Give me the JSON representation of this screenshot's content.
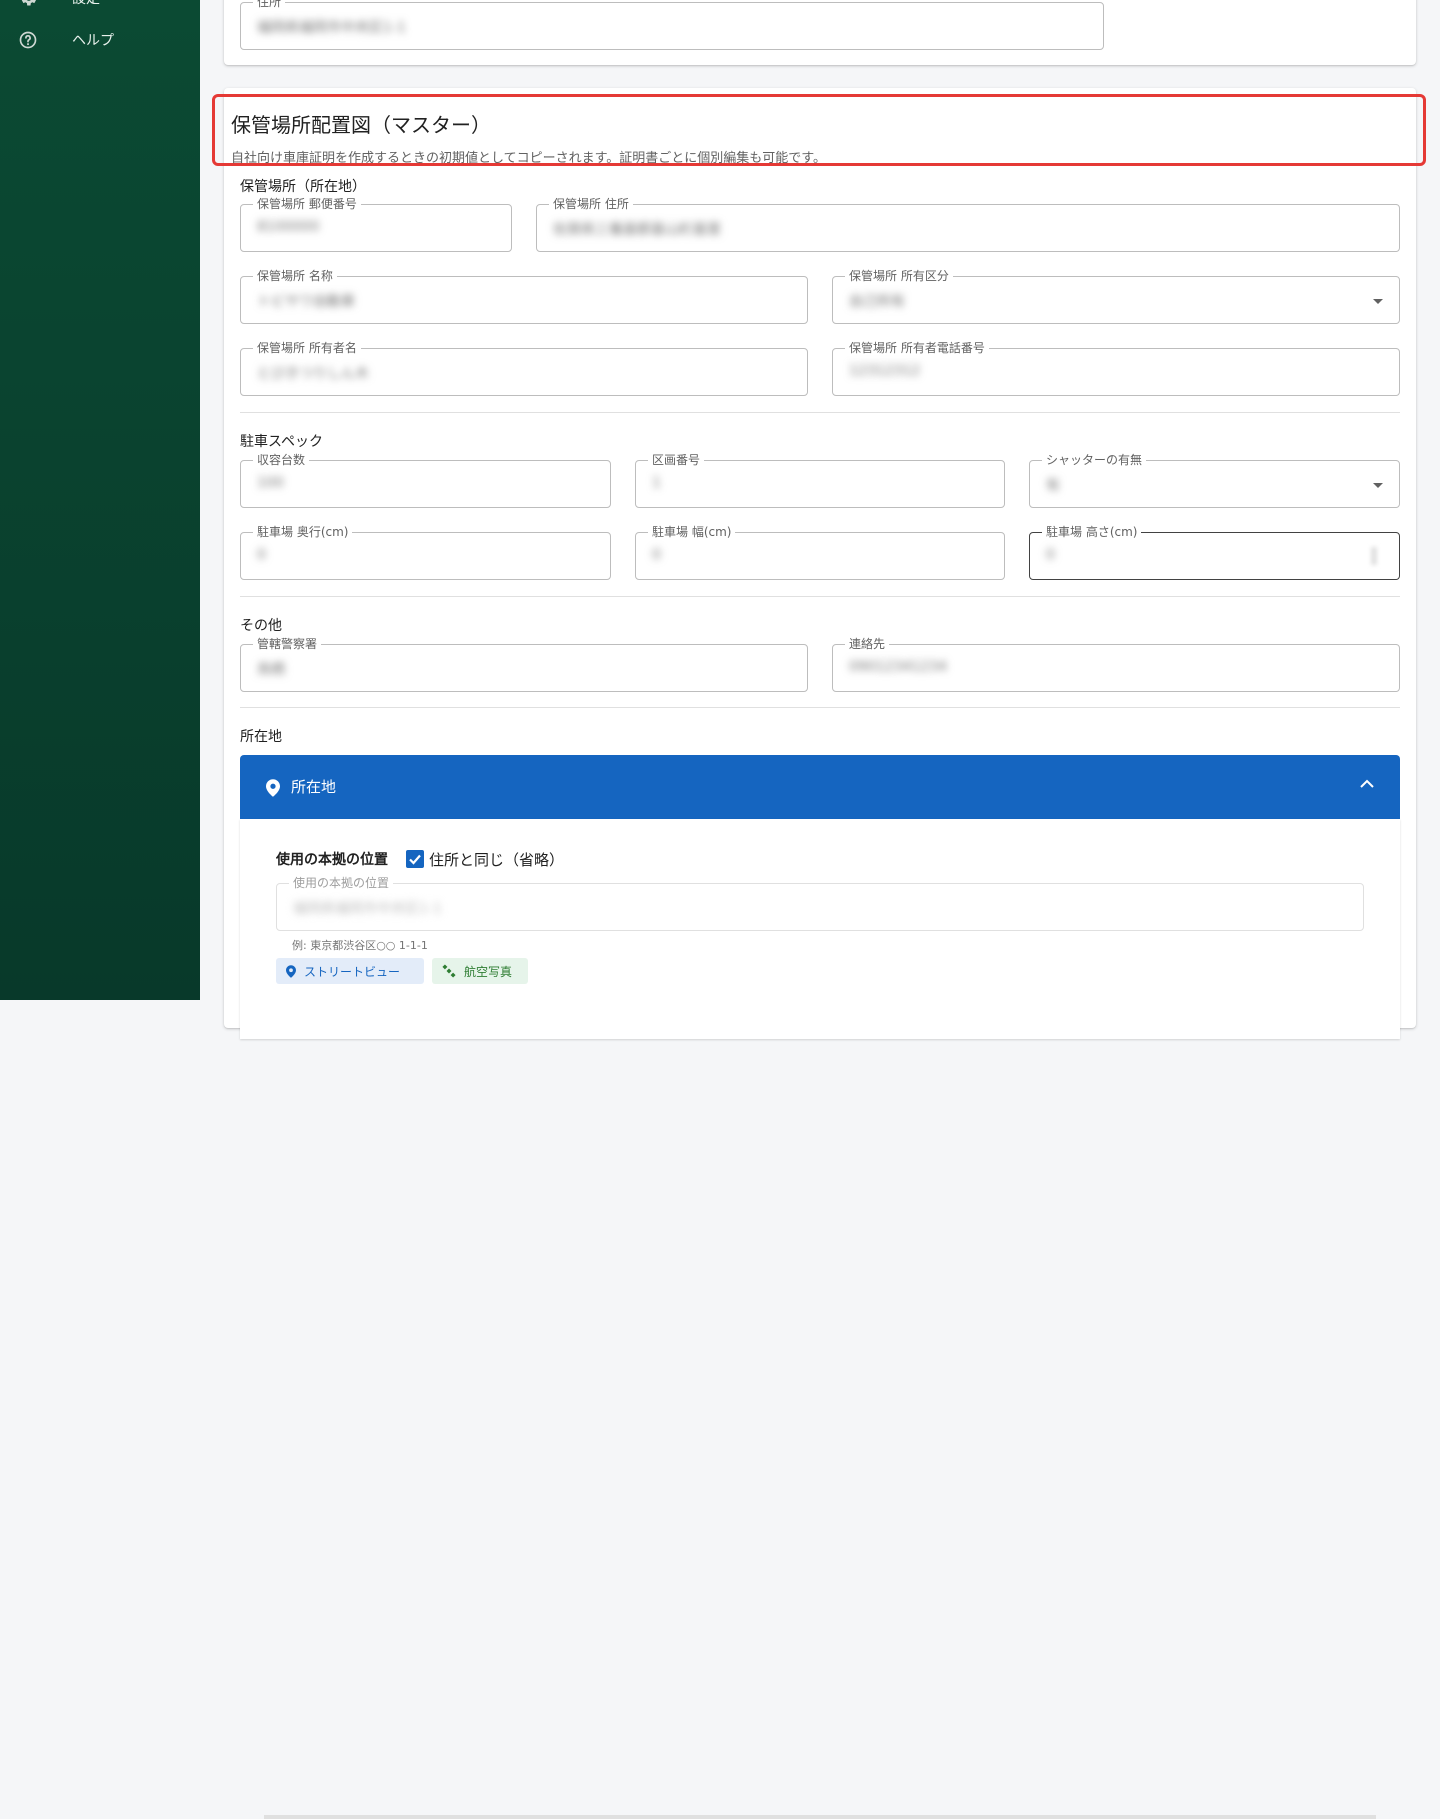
{
  "sidebar": {
    "items": [
      {
        "label": "設定",
        "icon": "gear-icon"
      },
      {
        "label": "ヘルプ",
        "icon": "help-circle-icon"
      }
    ]
  },
  "address_card": {
    "field": {
      "label": "住所",
      "value": "福岡県福岡市中央区1-1"
    }
  },
  "section": {
    "title": "保管場所配置図（マスター）",
    "description": "自社向け車庫証明を作成するときの初期値としてコピーされます。証明書ごとに個別編集も可能です。"
  },
  "location": {
    "heading": "保管場所（所在地）",
    "postal": {
      "label": "保管場所 郵便番号",
      "value": "8100000"
    },
    "address": {
      "label": "保管場所 住所",
      "value": "佐賀県三養基郡基山町基里"
    },
    "name": {
      "label": "保管場所 名称",
      "value": "トビサワ自動車"
    },
    "ownership": {
      "label": "保管場所 所有区分",
      "value": "自己所有"
    },
    "owner_name": {
      "label": "保管場所 所有者名",
      "value": "とびきつりしん木"
    },
    "owner_phone": {
      "label": "保管場所 所有者電話番号",
      "value": "12312312"
    }
  },
  "specs": {
    "heading": "駐車スペック",
    "capacity": {
      "label": "収容台数",
      "value": "100"
    },
    "section_no": {
      "label": "区画番号",
      "value": "1"
    },
    "shutter": {
      "label": "シャッターの有無",
      "value": "有"
    },
    "depth": {
      "label": "駐車場 奥行(cm)",
      "value": "0"
    },
    "width": {
      "label": "駐車場 幅(cm)",
      "value": "0"
    },
    "height": {
      "label": "駐車場 高さ(cm)",
      "value": "0"
    }
  },
  "other": {
    "heading": "その他",
    "police": {
      "label": "管轄警察署",
      "value": "鳥栖"
    },
    "contact": {
      "label": "連絡先",
      "value": "09012341234"
    }
  },
  "map": {
    "heading": "所在地",
    "panel_title": "所在地",
    "base_label": "使用の本拠の位置",
    "checkbox_label": "住所と同じ（省略）",
    "checked": true,
    "base_field": {
      "label": "使用の本拠の位置",
      "value": "福岡県福岡市中央区1-1"
    },
    "hint": "例: 東京都渋谷区○○ 1-1-1",
    "buttons": {
      "street_view": "ストリートビュー",
      "aerial": "航空写真"
    }
  },
  "colors": {
    "sidebar": "#0b4a33",
    "primary": "#1565c0",
    "highlight": "#e53935"
  }
}
